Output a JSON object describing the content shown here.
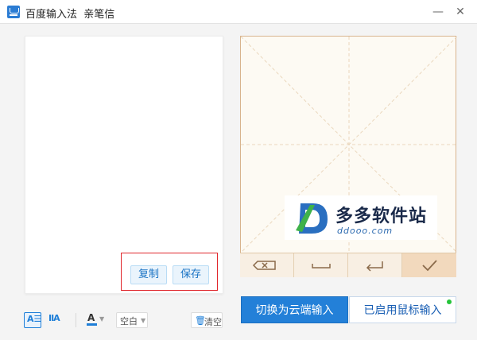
{
  "window": {
    "title": "百度输入法  亲笔信",
    "minimize_glyph": "—",
    "close_glyph": "✕"
  },
  "editor": {
    "text": "",
    "copy_label": "复制",
    "save_label": "保存"
  },
  "toolbar": {
    "layout_horizontal_glyph": "A☰",
    "layout_vertical_glyph": "IIA",
    "font_color_glyph": "A",
    "background_label": "空白",
    "clear_label": "清空",
    "clear_icon": "trash-icon",
    "accent_color": "#1f7fd8"
  },
  "handwriting_pad": {
    "keys": [
      {
        "name": "backspace",
        "icon": "backspace-icon"
      },
      {
        "name": "space",
        "icon": "space-icon"
      },
      {
        "name": "enter",
        "icon": "enter-icon"
      },
      {
        "name": "confirm",
        "icon": "check-icon"
      }
    ],
    "border_color": "#d8b48e"
  },
  "watermark": {
    "title": "多多软件站",
    "url": "ddooo.com"
  },
  "mode_buttons": {
    "cloud_label": "切换为云端输入",
    "mouse_label": "已启用鼠标输入",
    "mouse_status_color": "#25c43a"
  }
}
